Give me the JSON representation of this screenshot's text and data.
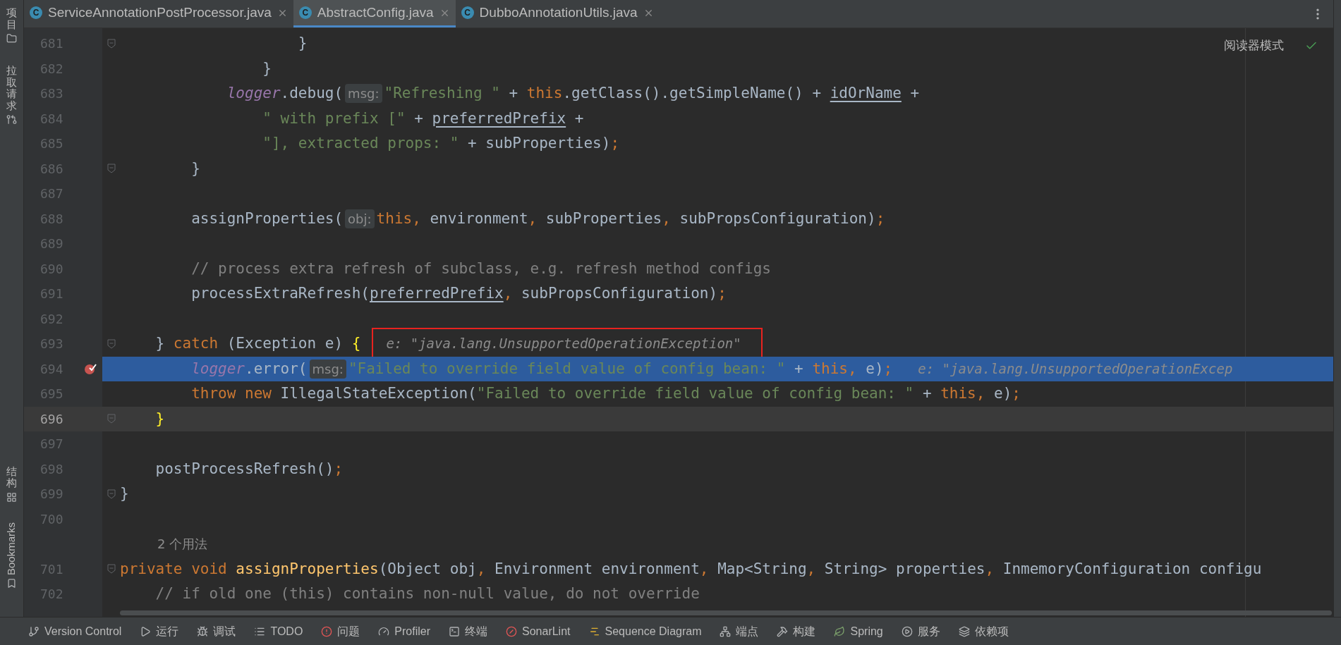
{
  "left_toolbar": [
    {
      "label": "项目"
    },
    {
      "label": "拉取请求"
    },
    {
      "label": "结构"
    },
    {
      "label": "Bookmarks"
    }
  ],
  "tabs": [
    {
      "icon_label": "C",
      "label": "ServiceAnnotationPostProcessor.java",
      "selected": false
    },
    {
      "icon_label": "C",
      "label": "AbstractConfig.java",
      "selected": true
    },
    {
      "icon_label": "C",
      "label": "DubboAnnotationUtils.java",
      "selected": false
    }
  ],
  "reader_mode": {
    "label": "阅读器模式"
  },
  "lines": [
    {
      "number": "681",
      "selected": false,
      "current": false,
      "breakpoint": false,
      "fold": true,
      "tokens": [
        {
          "kind": "plain",
          "text": "                    }"
        }
      ]
    },
    {
      "number": "682",
      "selected": false,
      "current": false,
      "breakpoint": false,
      "fold": false,
      "tokens": [
        {
          "kind": "plain",
          "text": "                }"
        }
      ]
    },
    {
      "number": "683",
      "selected": false,
      "current": false,
      "breakpoint": false,
      "fold": false,
      "tokens": [
        {
          "kind": "field",
          "text": "            logger"
        },
        {
          "kind": "plain",
          "text": ".debug("
        },
        {
          "kind": "hint",
          "text": "msg:"
        },
        {
          "kind": "string",
          "text": "\"Refreshing \""
        },
        {
          "kind": "plain",
          "text": " + "
        },
        {
          "kind": "keyword",
          "text": "this"
        },
        {
          "kind": "plain",
          "text": ".getClass().getSimpleName() + "
        },
        {
          "kind": "underline",
          "text": "idOrName"
        },
        {
          "kind": "plain",
          "text": " +"
        }
      ]
    },
    {
      "number": "684",
      "selected": false,
      "current": false,
      "breakpoint": false,
      "fold": false,
      "tokens": [
        {
          "kind": "string",
          "text": "                \" with prefix [\""
        },
        {
          "kind": "plain",
          "text": " + "
        },
        {
          "kind": "underline",
          "text": "preferredPrefix"
        },
        {
          "kind": "plain",
          "text": " +"
        }
      ]
    },
    {
      "number": "685",
      "selected": false,
      "current": false,
      "breakpoint": false,
      "fold": false,
      "tokens": [
        {
          "kind": "string",
          "text": "                \"], extracted props: \""
        },
        {
          "kind": "plain",
          "text": " + subProperties)"
        },
        {
          "kind": "keyword",
          "text": ";"
        }
      ]
    },
    {
      "number": "686",
      "selected": false,
      "current": false,
      "breakpoint": false,
      "fold": true,
      "tokens": [
        {
          "kind": "plain",
          "text": "        }"
        }
      ]
    },
    {
      "number": "687",
      "selected": false,
      "current": false,
      "breakpoint": false,
      "fold": false
    },
    {
      "number": "688",
      "selected": false,
      "current": false,
      "breakpoint": false,
      "fold": false,
      "tokens": [
        {
          "kind": "plain",
          "text": "        assignProperties("
        },
        {
          "kind": "hint",
          "text": "obj:"
        },
        {
          "kind": "keyword",
          "text": "this,"
        },
        {
          "kind": "plain",
          "text": " environment"
        },
        {
          "kind": "keyword",
          "text": ","
        },
        {
          "kind": "plain",
          "text": " subProperties"
        },
        {
          "kind": "keyword",
          "text": ","
        },
        {
          "kind": "plain",
          "text": " subPropsConfiguration)"
        },
        {
          "kind": "keyword",
          "text": ";"
        }
      ]
    },
    {
      "number": "689",
      "selected": false,
      "current": false,
      "breakpoint": false,
      "fold": false
    },
    {
      "number": "690",
      "selected": false,
      "current": false,
      "breakpoint": false,
      "fold": false,
      "tokens": [
        {
          "kind": "comment",
          "text": "        // process extra refresh of subclass, e.g. refresh method configs"
        }
      ]
    },
    {
      "number": "691",
      "selected": false,
      "current": false,
      "breakpoint": false,
      "fold": false,
      "tokens": [
        {
          "kind": "plain",
          "text": "        processExtraRefresh("
        },
        {
          "kind": "underline",
          "text": "preferredPrefix"
        },
        {
          "kind": "keyword",
          "text": ","
        },
        {
          "kind": "plain",
          "text": " subPropsConfiguration)"
        },
        {
          "kind": "keyword",
          "text": ";"
        }
      ]
    },
    {
      "number": "692",
      "selected": false,
      "current": false,
      "breakpoint": false,
      "fold": false
    },
    {
      "number": "693",
      "selected": false,
      "current": false,
      "breakpoint": false,
      "fold": true,
      "tokens": [
        {
          "kind": "plain",
          "text": "    } "
        },
        {
          "kind": "keyword",
          "text": "catch"
        },
        {
          "kind": "plain",
          "text": " (Exception e) "
        },
        {
          "kind": "brace",
          "text": "{"
        },
        {
          "kind": "inline",
          "boxed": true,
          "text": "e: \"java.lang.UnsupportedOperationException\""
        }
      ]
    },
    {
      "number": "694",
      "selected": true,
      "current": false,
      "breakpoint": true,
      "fold": false,
      "tokens": [
        {
          "kind": "field",
          "text": "        logger"
        },
        {
          "kind": "plain",
          "text": ".error("
        },
        {
          "kind": "hint",
          "text": "msg:"
        },
        {
          "kind": "string",
          "text": "\"Failed to override field value of config bean: \""
        },
        {
          "kind": "plain",
          "text": " + "
        },
        {
          "kind": "keyword",
          "text": "this,"
        },
        {
          "kind": "plain",
          "text": " e)"
        },
        {
          "kind": "keyword",
          "text": ";"
        },
        {
          "kind": "inline",
          "boxed": false,
          "text": "e: \"java.lang.UnsupportedOperationExcep"
        }
      ]
    },
    {
      "number": "695",
      "selected": false,
      "current": false,
      "breakpoint": false,
      "fold": false,
      "tokens": [
        {
          "kind": "keyword",
          "text": "        throw new"
        },
        {
          "kind": "plain",
          "text": " IllegalStateException("
        },
        {
          "kind": "string",
          "text": "\"Failed to override field value of config bean: \""
        },
        {
          "kind": "plain",
          "text": " + "
        },
        {
          "kind": "keyword",
          "text": "this,"
        },
        {
          "kind": "plain",
          "text": " e)"
        },
        {
          "kind": "keyword",
          "text": ";"
        }
      ]
    },
    {
      "number": "696",
      "selected": false,
      "current": true,
      "breakpoint": false,
      "fold": true,
      "tokens": [
        {
          "kind": "brace",
          "text": "    }"
        }
      ]
    },
    {
      "number": "697",
      "selected": false,
      "current": false,
      "breakpoint": false,
      "fold": false
    },
    {
      "number": "698",
      "selected": false,
      "current": false,
      "breakpoint": false,
      "fold": false,
      "tokens": [
        {
          "kind": "plain",
          "text": "    postProcessRefresh()"
        },
        {
          "kind": "keyword",
          "text": ";"
        }
      ]
    },
    {
      "number": "699",
      "selected": false,
      "current": false,
      "breakpoint": false,
      "fold": true,
      "tokens": [
        {
          "kind": "plain",
          "text": "}"
        }
      ]
    },
    {
      "number": "700",
      "selected": false,
      "current": false,
      "breakpoint": false,
      "fold": false
    },
    {
      "selected": false,
      "current": false,
      "breakpoint": false,
      "fold": false,
      "tokens": [
        {
          "kind": "usages",
          "text": "2 个用法"
        }
      ]
    },
    {
      "number": "701",
      "selected": false,
      "current": false,
      "breakpoint": false,
      "fold": true,
      "tokens": [
        {
          "kind": "keyword",
          "text": "private void"
        },
        {
          "kind": "method",
          "text": " assignProperties"
        },
        {
          "kind": "plain",
          "text": "(Object obj"
        },
        {
          "kind": "keyword",
          "text": ","
        },
        {
          "kind": "plain",
          "text": " Environment environment"
        },
        {
          "kind": "keyword",
          "text": ","
        },
        {
          "kind": "plain",
          "text": " Map<String"
        },
        {
          "kind": "keyword",
          "text": ","
        },
        {
          "kind": "plain",
          "text": " String> properties"
        },
        {
          "kind": "keyword",
          "text": ","
        },
        {
          "kind": "plain",
          "text": " InmemoryConfiguration configu"
        }
      ]
    },
    {
      "number": "702",
      "selected": false,
      "current": false,
      "breakpoint": false,
      "fold": false,
      "tokens": [
        {
          "kind": "comment",
          "text": "    // if old one (this) contains non-null value, do not override"
        }
      ]
    }
  ],
  "status_bar": [
    {
      "label": "Version Control"
    },
    {
      "label": "运行"
    },
    {
      "label": "调试"
    },
    {
      "label": "TODO"
    },
    {
      "label": "问题"
    },
    {
      "label": "Profiler"
    },
    {
      "label": "终端"
    },
    {
      "label": "SonarLint"
    },
    {
      "label": "Sequence Diagram"
    },
    {
      "label": "端点"
    },
    {
      "label": "构建"
    },
    {
      "label": "Spring"
    },
    {
      "label": "服务"
    },
    {
      "label": "依赖项"
    }
  ]
}
